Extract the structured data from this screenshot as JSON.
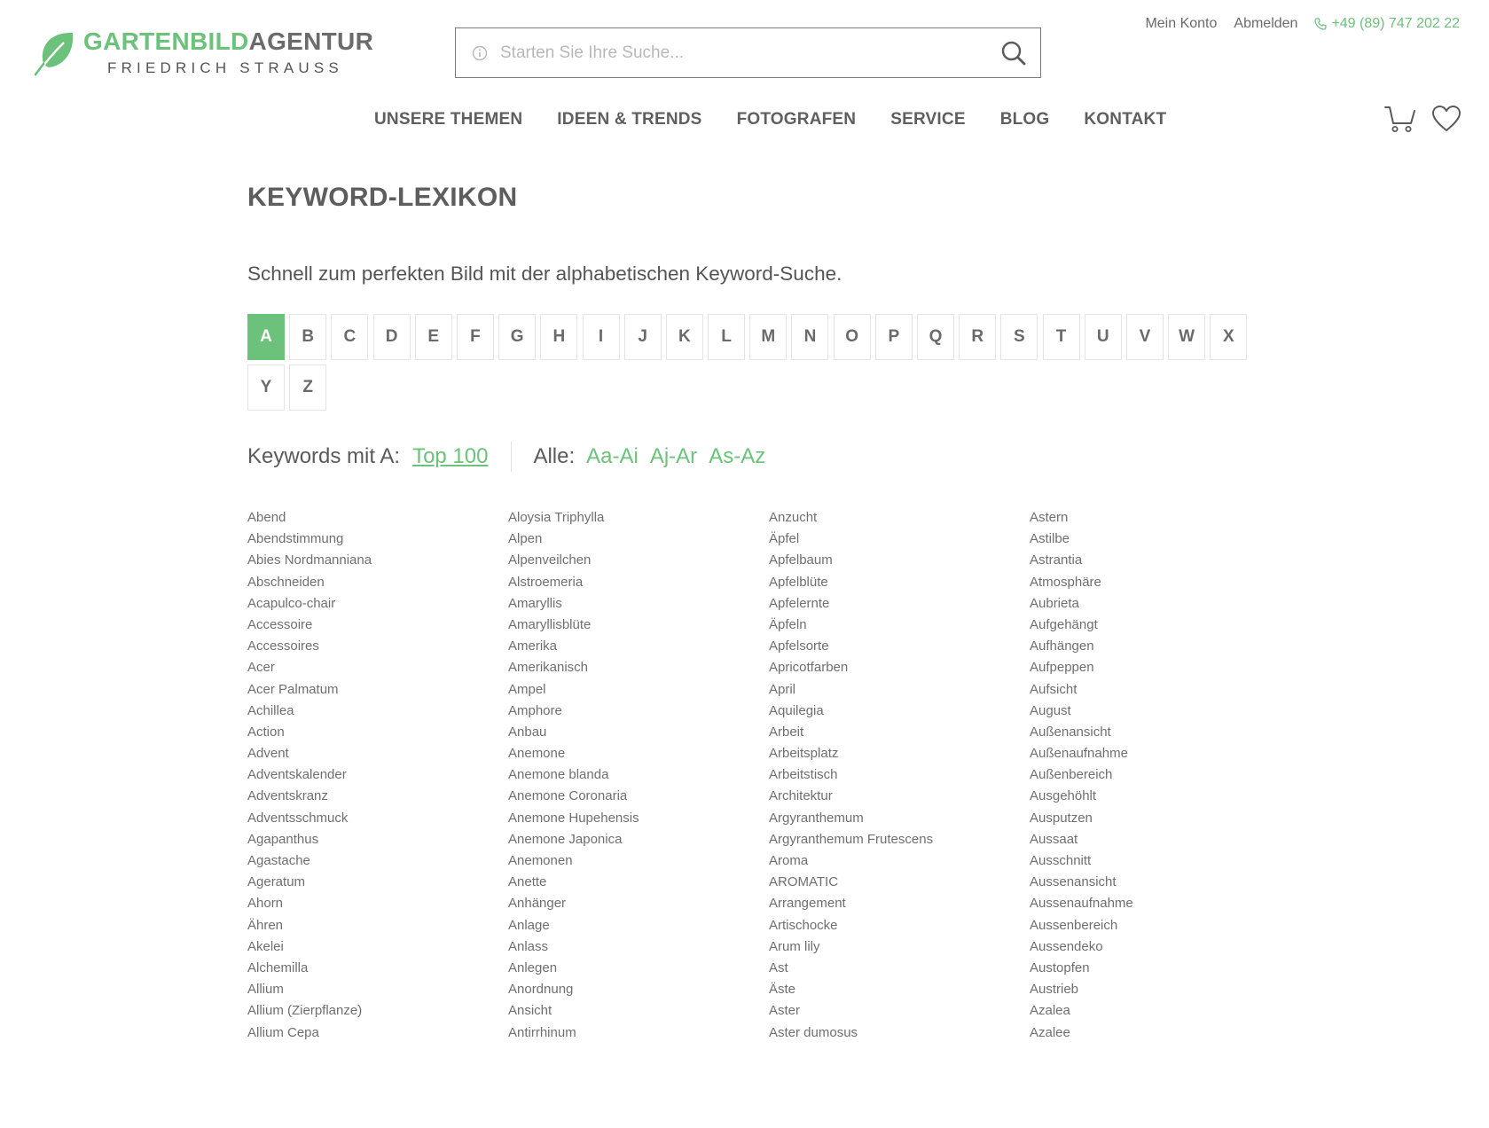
{
  "header": {
    "logo": {
      "part1": "GARTENBILD",
      "part2": "AGENTUR",
      "subtitle": "FRIEDRICH STRAUSS"
    },
    "search": {
      "placeholder": "Starten Sie Ihre Suche..."
    },
    "account": {
      "my_account": "Mein Konto",
      "logout": "Abmelden",
      "phone": "+49 (89) 747 202 22"
    },
    "nav": [
      "UNSERE THEMEN",
      "IDEEN & TRENDS",
      "FOTOGRAFEN",
      "SERVICE",
      "BLOG",
      "KONTAKT"
    ]
  },
  "page": {
    "title": "KEYWORD-LEXIKON",
    "intro": "Schnell zum perfekten Bild mit der alphabetischen Keyword-Suche.",
    "letters": [
      "A",
      "B",
      "C",
      "D",
      "E",
      "F",
      "G",
      "H",
      "I",
      "J",
      "K",
      "L",
      "M",
      "N",
      "O",
      "P",
      "Q",
      "R",
      "S",
      "T",
      "U",
      "V",
      "W",
      "X",
      "Y",
      "Z"
    ],
    "active_letter": "A",
    "keywords_label": "Keywords mit A:",
    "top100": "Top 100",
    "all_label": "Alle:",
    "ranges": [
      "Aa-Ai",
      "Aj-Ar",
      "As-Az"
    ],
    "columns": [
      [
        "Abend",
        "Abendstimmung",
        "Abies Nordmanniana",
        "Abschneiden",
        "Acapulco-chair",
        "Accessoire",
        "Accessoires",
        "Acer",
        "Acer Palmatum",
        "Achillea",
        "Action",
        "Advent",
        "Adventskalender",
        "Adventskranz",
        "Adventsschmuck",
        "Agapanthus",
        "Agastache",
        "Ageratum",
        "Ahorn",
        "Ähren",
        "Akelei",
        "Alchemilla",
        "Allium",
        "Allium (Zierpflanze)",
        "Allium Cepa"
      ],
      [
        "Aloysia Triphylla",
        "Alpen",
        "Alpenveilchen",
        "Alstroemeria",
        "Amaryllis",
        "Amaryllisblüte",
        "Amerika",
        "Amerikanisch",
        "Ampel",
        "Amphore",
        "Anbau",
        "Anemone",
        "Anemone blanda",
        "Anemone Coronaria",
        "Anemone Hupehensis",
        "Anemone Japonica",
        "Anemonen",
        "Anette",
        "Anhänger",
        "Anlage",
        "Anlass",
        "Anlegen",
        "Anordnung",
        "Ansicht",
        "Antirrhinum"
      ],
      [
        "Anzucht",
        "Äpfel",
        "Apfelbaum",
        "Apfelblüte",
        "Apfelernte",
        "Äpfeln",
        "Apfelsorte",
        "Apricotfarben",
        "April",
        "Aquilegia",
        "Arbeit",
        "Arbeitsplatz",
        "Arbeitstisch",
        "Architektur",
        "Argyranthemum",
        "Argyranthemum Frutescens",
        "Aroma",
        "AROMATIC",
        "Arrangement",
        "Artischocke",
        "Arum lily",
        "Ast",
        "Äste",
        "Aster",
        "Aster dumosus"
      ],
      [
        "Astern",
        "Astilbe",
        "Astrantia",
        "Atmosphäre",
        "Aubrieta",
        "Aufgehängt",
        "Aufhängen",
        "Aufpeppen",
        "Aufsicht",
        "August",
        "Außenansicht",
        "Außenaufnahme",
        "Außenbereich",
        "Ausgehöhlt",
        "Ausputzen",
        "Aussaat",
        "Ausschnitt",
        "Aussenansicht",
        "Aussenaufnahme",
        "Aussenbereich",
        "Aussendeko",
        "Austopfen",
        "Austrieb",
        "Azalea",
        "Azalee"
      ]
    ]
  },
  "colors": {
    "accent": "#6cc27a",
    "text": "#6e6e6e",
    "border": "#e4e4e4"
  }
}
